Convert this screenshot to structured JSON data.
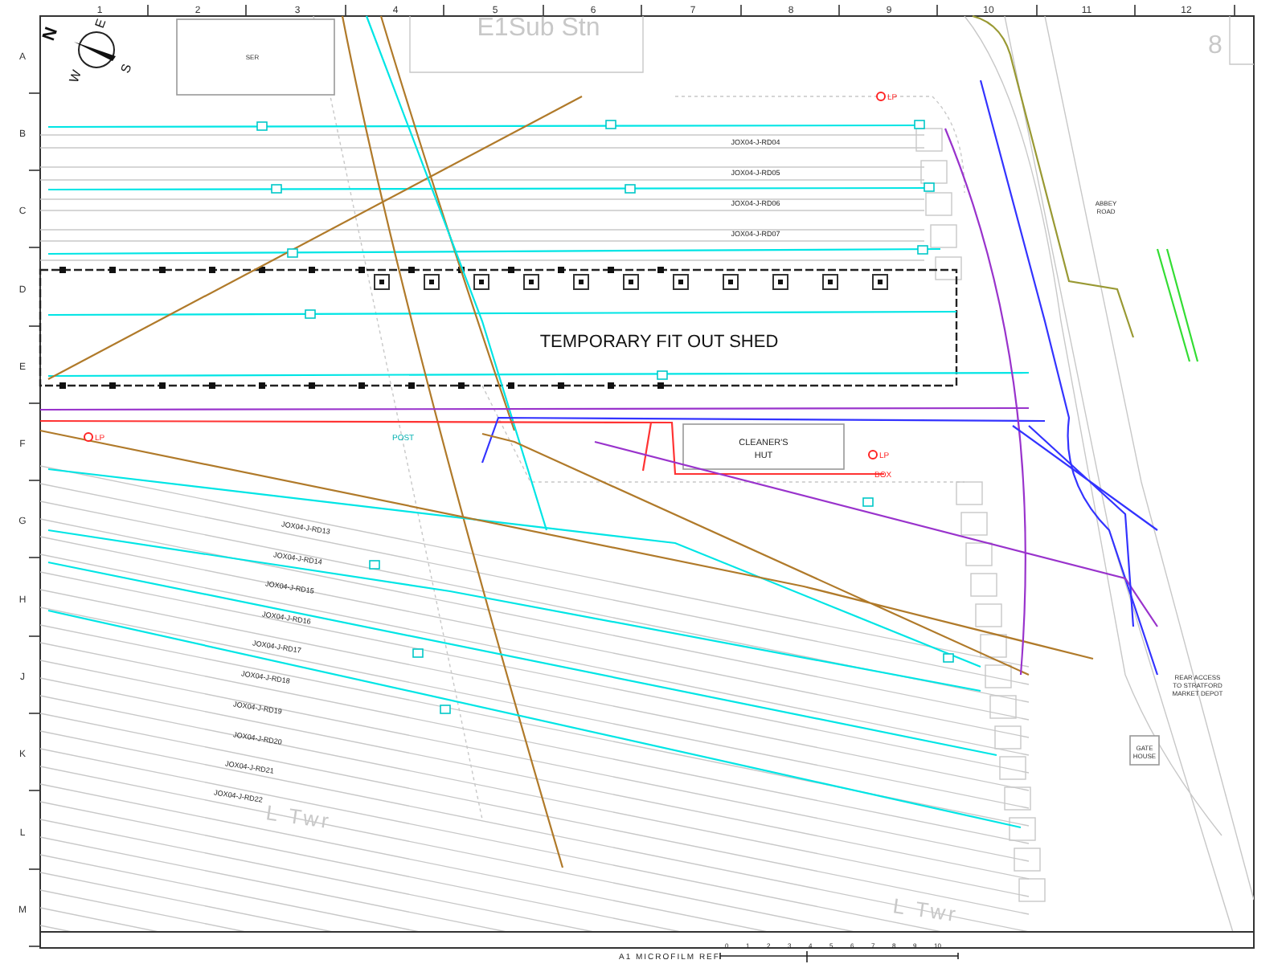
{
  "grid": {
    "columns": [
      "1",
      "2",
      "3",
      "4",
      "5",
      "6",
      "7",
      "8",
      "9",
      "10",
      "11",
      "12"
    ],
    "rows": [
      "A",
      "B",
      "C",
      "D",
      "E",
      "F",
      "G",
      "H",
      "J",
      "K",
      "L",
      "M"
    ]
  },
  "compass": {
    "north": "N",
    "east": "E",
    "south": "S",
    "west": "W"
  },
  "buildings": [
    {
      "label": "SER"
    },
    {
      "label": "TEMPORARY FIT OUT SHED"
    },
    {
      "label": "CLEANER'S HUT"
    },
    {
      "label": "GATE HOUSE"
    }
  ],
  "place_labels": [
    "E1Sub Stn",
    "8",
    "ABBEY ROAD",
    "REAR ACCESS TO STRATFORD MARKET DEPOT",
    "L Twr",
    "L Twr"
  ],
  "road_labels": [
    "JOX04-J-RD04",
    "JOX04-J-RD05",
    "JOX04-J-RD06",
    "JOX04-J-RD07",
    "JOX04-J-RD13",
    "JOX04-J-RD14",
    "JOX04-J-RD15",
    "JOX04-J-RD16",
    "JOX04-J-RD17",
    "JOX04-J-RD18",
    "JOX04-J-RD19",
    "JOX04-J-RD20",
    "JOX04-J-RD21",
    "JOX04-J-RD22"
  ],
  "markers": [
    {
      "label": "LP"
    },
    {
      "label": "LP"
    },
    {
      "label": "LP"
    },
    {
      "label": "BOX"
    },
    {
      "label": "POST"
    }
  ],
  "utility_lines": [
    {
      "color": "#00e5e5"
    },
    {
      "color": "#00e5e5"
    },
    {
      "color": "#00e5e5"
    },
    {
      "color": "#00e5e5"
    },
    {
      "color": "#00e5e5"
    },
    {
      "color": "#b07a2a"
    },
    {
      "color": "#b07a2a"
    },
    {
      "color": "#b07a2a"
    },
    {
      "color": "#00e5e5"
    },
    {
      "color": "#9933cc"
    },
    {
      "color": "#ff3333"
    },
    {
      "color": "#3333ff"
    },
    {
      "color": "#999933"
    },
    {
      "color": "#33dd33"
    },
    {
      "color": "#00e5e5"
    },
    {
      "color": "#00e5e5"
    },
    {
      "color": "#00e5e5"
    },
    {
      "color": "#b07a2a"
    },
    {
      "color": "#9933cc"
    },
    {
      "color": "#3333ff"
    }
  ],
  "scale_bar": {
    "title": "A1 MICROFILM REF",
    "ticks": [
      "0",
      "1",
      "2",
      "3",
      "4",
      "5",
      "6",
      "7",
      "8",
      "9",
      "10"
    ]
  }
}
